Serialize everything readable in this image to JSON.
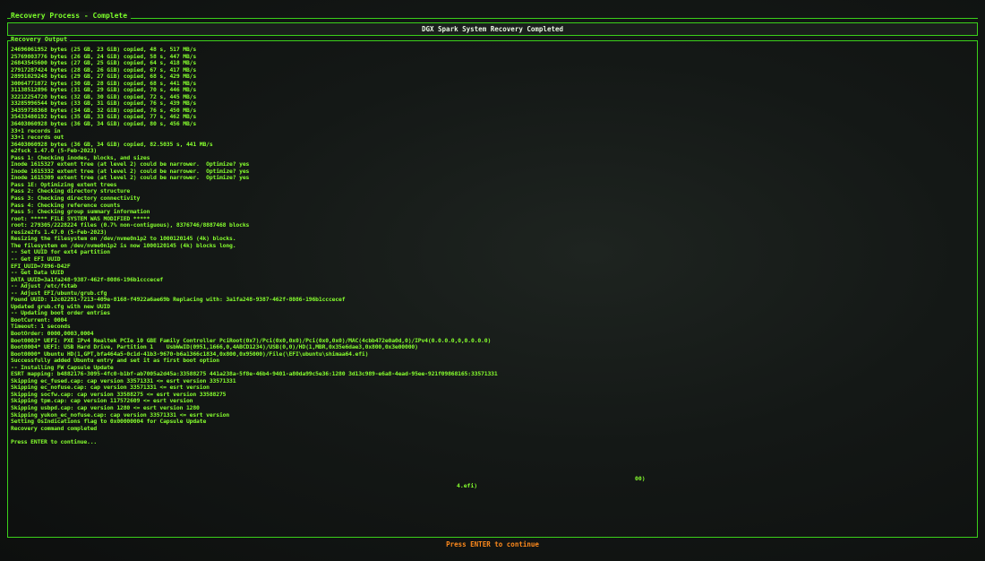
{
  "window": {
    "title": "Recovery Process - Complete",
    "header": "DGX Spark System Recovery Completed"
  },
  "panel": {
    "label": "Recovery Output",
    "lines": [
      "24696061952 bytes (25 GB, 23 GiB) copied, 48 s, 517 MB/s",
      "25769803776 bytes (26 GB, 24 GiB) copied, 58 s, 447 MB/s",
      "26843545600 bytes (27 GB, 25 GiB) copied, 64 s, 418 MB/s",
      "27917287424 bytes (28 GB, 26 GiB) copied, 67 s, 417 MB/s",
      "28991029248 bytes (29 GB, 27 GiB) copied, 68 s, 429 MB/s",
      "30064771072 bytes (30 GB, 28 GiB) copied, 68 s, 441 MB/s",
      "31138512896 bytes (31 GB, 29 GiB) copied, 70 s, 446 MB/s",
      "32212254720 bytes (32 GB, 30 GiB) copied, 72 s, 445 MB/s",
      "33285996544 bytes (33 GB, 31 GiB) copied, 76 s, 439 MB/s",
      "34359738368 bytes (34 GB, 32 GiB) copied, 76 s, 450 MB/s",
      "35433480192 bytes (35 GB, 33 GiB) copied, 77 s, 462 MB/s",
      "36403060928 bytes (36 GB, 34 GiB) copied, 80 s, 456 MB/s",
      "33+1 records in",
      "33+1 records out",
      "36403060928 bytes (36 GB, 34 GiB) copied, 82.5035 s, 441 MB/s",
      "e2fsck 1.47.0 (5-Feb-2023)",
      "Pass 1: Checking inodes, blocks, and sizes",
      "Inode 1615327 extent tree (at level 2) could be narrower.  Optimize? yes",
      "Inode 1615332 extent tree (at level 2) could be narrower.  Optimize? yes",
      "Inode 1615309 extent tree (at level 2) could be narrower.  Optimize? yes",
      "Pass 1E: Optimizing extent trees",
      "Pass 2: Checking directory structure",
      "Pass 3: Checking directory connectivity",
      "Pass 4: Checking reference counts",
      "Pass 5: Checking group summary information",
      "root: ***** FILE SYSTEM WAS MODIFIED *****",
      "root: 279305/2228224 files (0.7% non-contiguous), 8376746/8887468 blocks",
      "resize2fs 1.47.0 (5-Feb-2023)",
      "Resizing the filesystem on /dev/nvme0n1p2 to 1000120145 (4k) blocks.",
      "The filesystem on /dev/nvme0n1p2 is now 1000120145 (4k) blocks long.",
      "-- Set UUID for ext4 partition",
      "-- Get EFI UUID",
      "EFI_UUID=7896-D42F",
      "-- Get Data UUID",
      "DATA_UUID=3a1fa248-9387-462f-8086-196b1cccecef",
      "-- Adjust /etc/fstab",
      "-- Adjust EFI/ubuntu/grub.cfg",
      "Found UUID: 12c02291-7213-409e-8168-f4922a6ae69b Replacing with: 3a1fa248-9387-462f-8086-196b1cccecef",
      "Updated grub.cfg with new UUID",
      "-- Updating boot order entries",
      "BootCurrent: 0004",
      "Timeout: 1 seconds",
      "BootOrder: 0000,0003,0004",
      "Boot0003* UEFI: PXE IPv4 Realtek PCIe 10 GBE Family Controller PciRoot(0x7)/Pci(0x0,0x0)/Pci(0x0,0x0)/MAC(4cbb472e0a0d,0)/IPv4(0.0.0.0,0,0.0.0.0)",
      "Boot0004* UEFI: USB Hard Drive, Partition 1    UsbWwID(0951,1666,0,4ABCD1234)/USB(0,0)/HD(1,MBR,0x35e6dae3,0x800,0x3e00000)",
      "Boot0000* Ubuntu HD(1,GPT,bfa464a5-0c1d-41b3-9670-b6a1366c1834,0x800,0x95000)/File(\\EFI\\ubuntu\\shimaa64.efi)",
      "Successfully added Ubuntu entry and set it as first boot option",
      "-- Installing FW Capsule Update",
      "ESRT mapping: b4882176-3095-4fc0-b1bf-ab7005a2d45a:33588275 441a238a-5f8e-46b4-9401-a80da99c5e36:1280 3d13c989-e6a8-4ead-95ee-921f09868165:33571331",
      "Skipping ec_fused.cap: cap version 33571331 <= esrt version 33571331",
      "Skipping ec_nofuse.cap: cap version 33571331 <= esrt version",
      "Skipping socfw.cap: cap version 33588275 <= esrt version 33588275",
      "Skipping tpm.cap: cap version 117572609 <= esrt version",
      "Skipping usbpd.cap: cap version 1280 <= esrt version 1280",
      "Skipping yukon_ec_nofuse.cap: cap version 33571331 <= esrt version",
      "Setting OsIndications flag to 0x00000004 for Capsule Update",
      "Recovery command completed",
      "",
      "Press ENTER to continue..."
    ],
    "stray_a": "4.efi)",
    "stray_b": "00)"
  },
  "footer": {
    "prompt": "Press ENTER to continue"
  }
}
